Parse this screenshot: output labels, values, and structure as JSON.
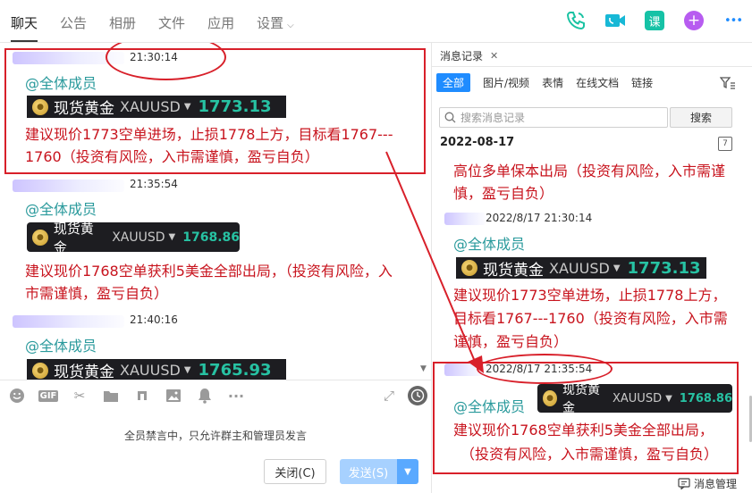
{
  "tabs": [
    {
      "label": "聊天",
      "active": true
    },
    {
      "label": "公告"
    },
    {
      "label": "相册"
    },
    {
      "label": "文件"
    },
    {
      "label": "应用"
    },
    {
      "label": "设置"
    }
  ],
  "top_icons": [
    "phone-icon",
    "video-call-icon",
    "course-icon",
    "add-icon",
    "more-icon"
  ],
  "top_icon_labels": {
    "course": "课",
    "add": "+",
    "more": "•••"
  },
  "top_icon_colors": {
    "phone": "#19c2a2",
    "video": "#17b8d6",
    "course": "#16c2a6",
    "add": "#b75cf0",
    "more": "#1f8cff"
  },
  "chat": {
    "messages": [
      {
        "time": "21:30:14",
        "mention": "@全体成员",
        "quote": {
          "name": "现货黄金",
          "symbol": "XAUUSD",
          "price": "1773.13"
        },
        "text_line1": "建议现价1773空单进场，止损1778上方，目标看1767---",
        "text_line2": "1760（投资有风险，入市需谨慎，盈亏自负）"
      },
      {
        "time": "21:35:54",
        "mention": "@全体成员",
        "quote": {
          "name": "现货黄金",
          "symbol": "XAUUSD",
          "price": "1768.86"
        },
        "text_line1": "建议现价1768空单获利5美金全部出局，（投资有风险，入",
        "text_line2": "市需谨慎，盈亏自负）"
      },
      {
        "time": "21:40:16",
        "mention": "@全体成员",
        "quote": {
          "name": "现货黄金",
          "symbol": "XAUUSD",
          "price": "1765.93"
        }
      }
    ]
  },
  "toolbar": {
    "items": [
      "emoji-icon",
      "gif-icon",
      "scissors-icon",
      "folder-icon",
      "music-icon",
      "image-icon",
      "bell-icon",
      "more-icon"
    ],
    "gif_label": "GIF",
    "more_label": "···"
  },
  "composer": {
    "mute_notice": "全员禁言中，只允许群主和管理员发言",
    "close_label": "关闭(C)",
    "send_label": "发送(S)"
  },
  "history": {
    "tab_label": "消息记录",
    "tab_close": "✕",
    "filters": [
      "全部",
      "图片/视频",
      "表情",
      "在线文档",
      "链接"
    ],
    "search_placeholder": "搜索消息记录",
    "search_button": "搜索",
    "date": "2022-08-17",
    "calendar_label": "7",
    "entries": [
      {
        "text_line1": "高位多单保本出局（投资有风险，入市需谨",
        "text_line2": "慎，盈亏自负）"
      },
      {
        "time": "2022/8/17 21:30:14",
        "mention": "@全体成员",
        "quote": {
          "name": "现货黄金",
          "symbol": "XAUUSD",
          "price": "1773.13"
        },
        "text_line1": "建议现价1773空单进场，止损1778上方，",
        "text_line2": "目标看1767---1760（投资有风险，入市需",
        "text_line3": "谨慎，盈亏自负）"
      },
      {
        "time": "2022/8/17 21:35:54",
        "mention": "@全体成员",
        "quote": {
          "name": "现货黄金",
          "symbol": "XAUUSD",
          "price": "1768.86"
        },
        "text_line1": "建议现价1768空单获利5美金全部出局，",
        "text_line2": "（投资有风险，入市需谨慎，盈亏自负）"
      }
    ],
    "footer_label": "消息管理"
  },
  "colors": {
    "warning_red": "#c8141e",
    "mention_teal": "#2a9a9c",
    "price_green": "#27c2a3",
    "accent_blue": "#1f8cff",
    "annotation_red": "#d8202a"
  }
}
